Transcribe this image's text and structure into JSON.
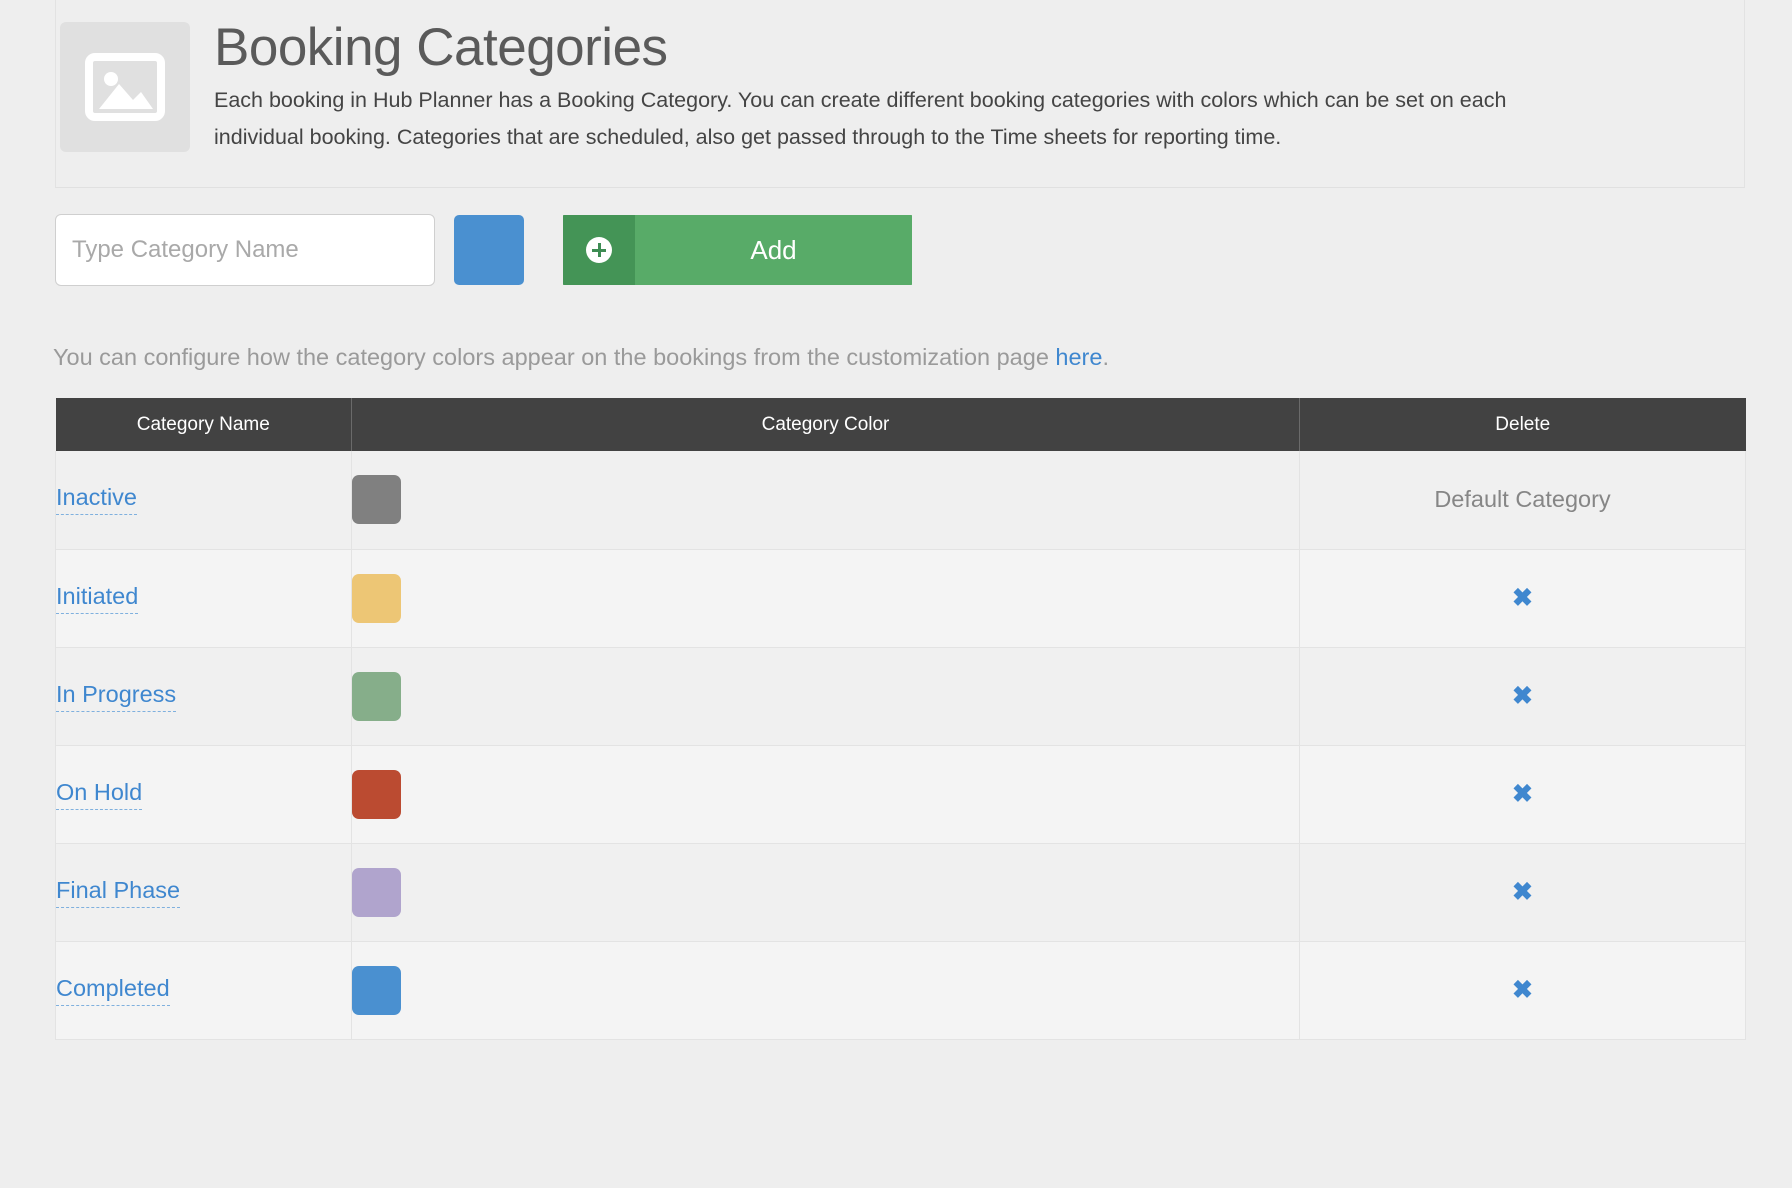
{
  "header": {
    "icon": "image-placeholder-icon",
    "title": "Booking Categories",
    "description": "Each booking in Hub Planner has a Booking Category. You can create different booking categories with colors which can be set on each individual booking. Categories that are scheduled, also get passed through to the Time sheets for reporting time."
  },
  "create_form": {
    "input_placeholder": "Type Category Name",
    "input_value": "",
    "color_swatch": "#4a90d0",
    "add_button_label": "Add",
    "add_button_icon": "plus-circle-icon",
    "add_button_color": "#58ab68",
    "add_button_icon_bg": "#449456"
  },
  "helper": {
    "text_before": "You can configure how the category colors appear on the bookings from the customization page ",
    "link_label": "here",
    "text_after": ".",
    "link_color": "#3f87cf"
  },
  "table": {
    "columns": [
      "Category Name",
      "Category Color",
      "Delete"
    ],
    "delete_icon": "cross-icon",
    "rows": [
      {
        "name": "Inactive",
        "color": "#808080",
        "delete_label": "Default Category",
        "deletable": false
      },
      {
        "name": "Initiated",
        "color": "#edc675",
        "delete_label": "",
        "deletable": true
      },
      {
        "name": "In Progress",
        "color": "#86ae8a",
        "delete_label": "",
        "deletable": true
      },
      {
        "name": "On Hold",
        "color": "#bb4b31",
        "delete_label": "",
        "deletable": true
      },
      {
        "name": "Final Phase",
        "color": "#b0a4cd",
        "delete_label": "",
        "deletable": true
      },
      {
        "name": "Completed",
        "color": "#4a90d0",
        "delete_label": "",
        "deletable": true
      }
    ]
  }
}
